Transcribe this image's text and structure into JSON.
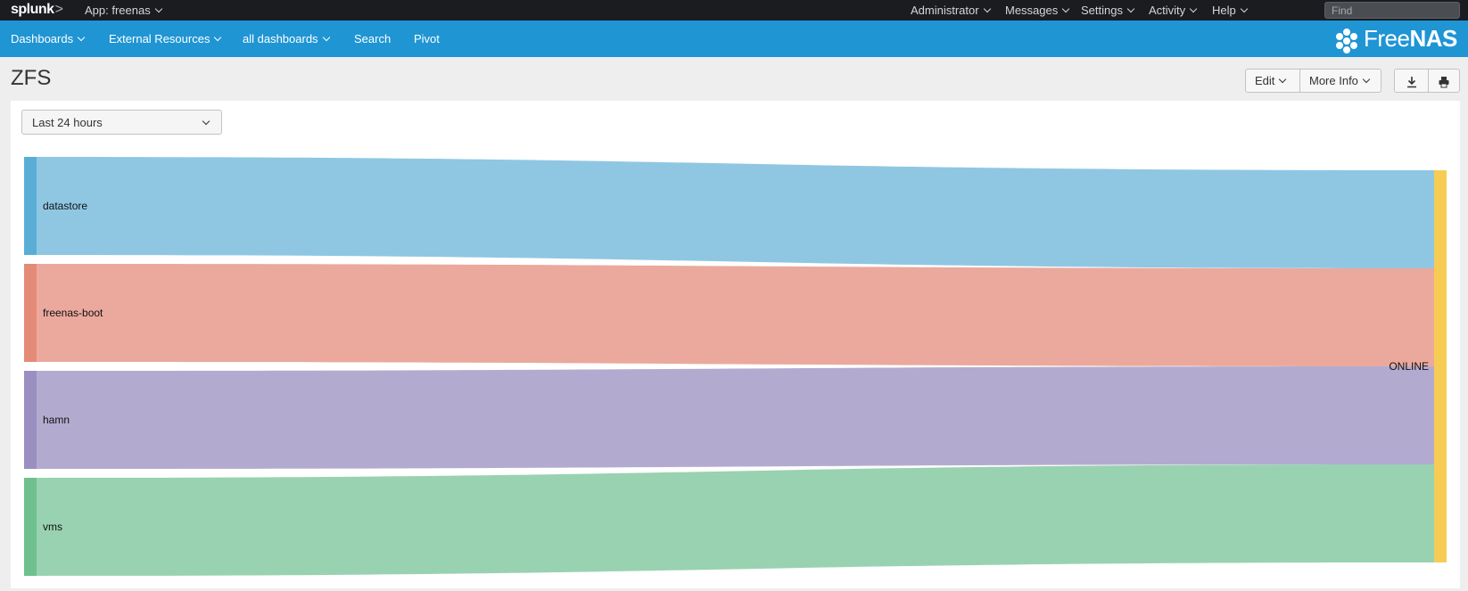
{
  "topbar": {
    "logo": "splunk",
    "logo_chevron": ">",
    "app_menu": "App: freenas",
    "menus": [
      "Administrator",
      "Messages",
      "Settings",
      "Activity",
      "Help"
    ],
    "find_placeholder": "Find"
  },
  "bluebar": {
    "nav": [
      "Dashboards",
      "External Resources",
      "all dashboards",
      "Search",
      "Pivot"
    ],
    "brand_light": "Free",
    "brand_bold": "NAS"
  },
  "page": {
    "title": "ZFS",
    "edit_label": "Edit",
    "more_info_label": "More Info",
    "download_icon": "download-icon",
    "print_icon": "print-icon"
  },
  "timepicker": {
    "value": "Last 24 hours"
  },
  "chart_data": {
    "type": "sankey",
    "sources": [
      {
        "name": "datastore",
        "value": 1,
        "color": "#5aaed6",
        "link_color": "#8fc7e3"
      },
      {
        "name": "freenas-boot",
        "value": 1,
        "color": "#e48b78",
        "link_color": "#eaa99c"
      },
      {
        "name": "hamn",
        "value": 1,
        "color": "#9a8fc0",
        "link_color": "#b3abcf"
      },
      {
        "name": "vms",
        "value": 1,
        "color": "#6fc08f",
        "link_color": "#99d2b0"
      }
    ],
    "targets": [
      {
        "name": "ONLINE",
        "value": 4,
        "color": "#f7cc55"
      }
    ]
  }
}
